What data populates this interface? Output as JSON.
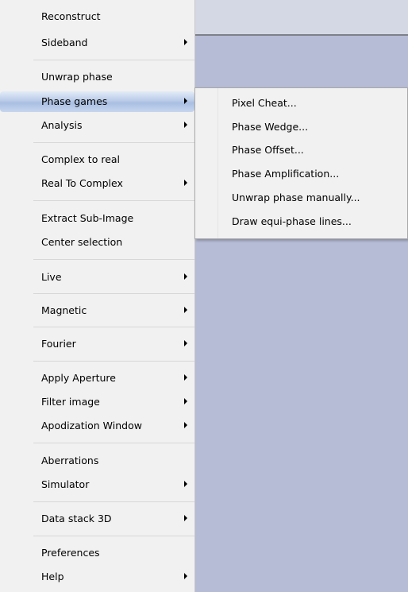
{
  "main_menu": {
    "items": [
      {
        "label": "Reconstruct",
        "submenu": false
      },
      {
        "label": "Sideband",
        "submenu": true
      },
      {
        "label": "Unwrap phase",
        "submenu": false
      },
      {
        "label": "Phase games",
        "submenu": true,
        "highlighted": true
      },
      {
        "label": "Analysis",
        "submenu": true
      },
      {
        "label": "Complex to real",
        "submenu": false
      },
      {
        "label": "Real To Complex",
        "submenu": true
      },
      {
        "label": "Extract Sub-Image",
        "submenu": false
      },
      {
        "label": "Center selection",
        "submenu": false
      },
      {
        "label": "Live",
        "submenu": true
      },
      {
        "label": "Magnetic",
        "submenu": true
      },
      {
        "label": "Fourier",
        "submenu": true
      },
      {
        "label": "Apply Aperture",
        "submenu": true
      },
      {
        "label": "Filter image",
        "submenu": true
      },
      {
        "label": "Apodization Window",
        "submenu": true
      },
      {
        "label": "Aberrations",
        "submenu": false
      },
      {
        "label": "Simulator",
        "submenu": true
      },
      {
        "label": "Data stack 3D",
        "submenu": true
      },
      {
        "label": "Preferences",
        "submenu": false
      },
      {
        "label": "Help",
        "submenu": true
      }
    ]
  },
  "phase_games_submenu": {
    "items": [
      {
        "label": "Pixel Cheat..."
      },
      {
        "label": "Phase Wedge..."
      },
      {
        "label": "Phase Offset..."
      },
      {
        "label": "Phase Amplification..."
      },
      {
        "label": "Unwrap phase manually..."
      },
      {
        "label": "Draw equi-phase lines..."
      }
    ]
  },
  "colors": {
    "desktop_background": "#b6bcd6",
    "menu_background": "#f1f1f1",
    "highlight_blue": "#b9cbe7"
  }
}
